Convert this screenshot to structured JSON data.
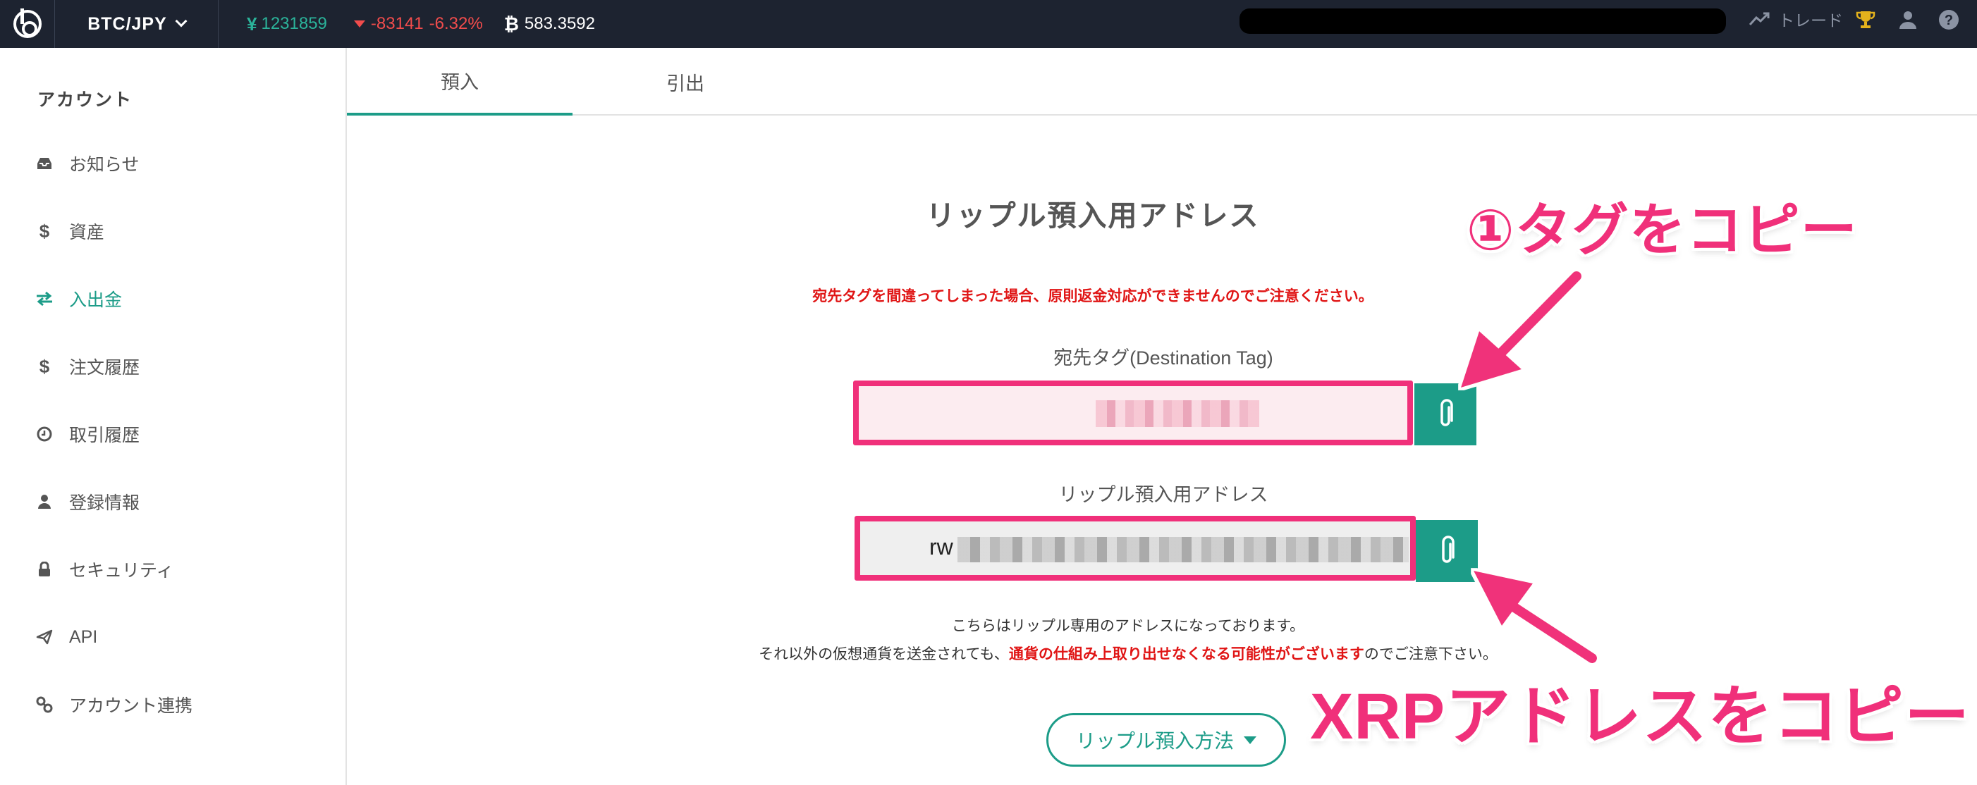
{
  "topbar": {
    "pair": "BTC/JPY",
    "price": "1231859",
    "price_currency": "¥",
    "change": "-83141",
    "change_pct": "-6.32%",
    "btc_symbol": "₿",
    "volume": "583.3592",
    "trade_label": "トレード",
    "colors": {
      "bar_bg": "#1d2330",
      "up": "#2bb39a",
      "down": "#f14c4c"
    }
  },
  "sidebar": {
    "title": "アカウント",
    "items": [
      {
        "label": "お知らせ",
        "icon": "inbox-icon",
        "active": false
      },
      {
        "label": "資産",
        "icon": "dollar-icon",
        "active": false
      },
      {
        "label": "入出金",
        "icon": "exchange-icon",
        "active": true
      },
      {
        "label": "注文履歴",
        "icon": "dollar-icon",
        "active": false
      },
      {
        "label": "取引履歴",
        "icon": "clock-icon",
        "active": false
      },
      {
        "label": "登録情報",
        "icon": "user-icon",
        "active": false
      },
      {
        "label": "セキュリティ",
        "icon": "lock-icon",
        "active": false
      },
      {
        "label": "API",
        "icon": "paper-plane-icon",
        "active": false
      },
      {
        "label": "アカウント連携",
        "icon": "link-icon",
        "active": false
      }
    ]
  },
  "tabs": [
    {
      "label": "預入",
      "active": true
    },
    {
      "label": "引出",
      "active": false
    }
  ],
  "main": {
    "title": "リップル預入用アドレス",
    "warning": "宛先タグを間違ってしまった場合、原則返金対応ができませんのでご注意ください。",
    "dest_tag_label": "宛先タグ(Destination Tag)",
    "address_label": "リップル預入用アドレス",
    "address_prefix": "rw",
    "note_line1": "こちらはリップル専用のアドレスになっております。",
    "note_line2_pre": "それ以外の仮想通貨を送金されても、",
    "note_line2_red": "通貨の仕組み上取り出せなくなる可能性がございます",
    "note_line2_post": "のでご注意下さい。",
    "method_button": "リップル預入方法"
  },
  "annotations": {
    "copy_tag": "①タグをコピー",
    "copy_address": "XRPアドレスをコピー",
    "color": "#f0307a"
  },
  "accent_color": "#1c9c88"
}
